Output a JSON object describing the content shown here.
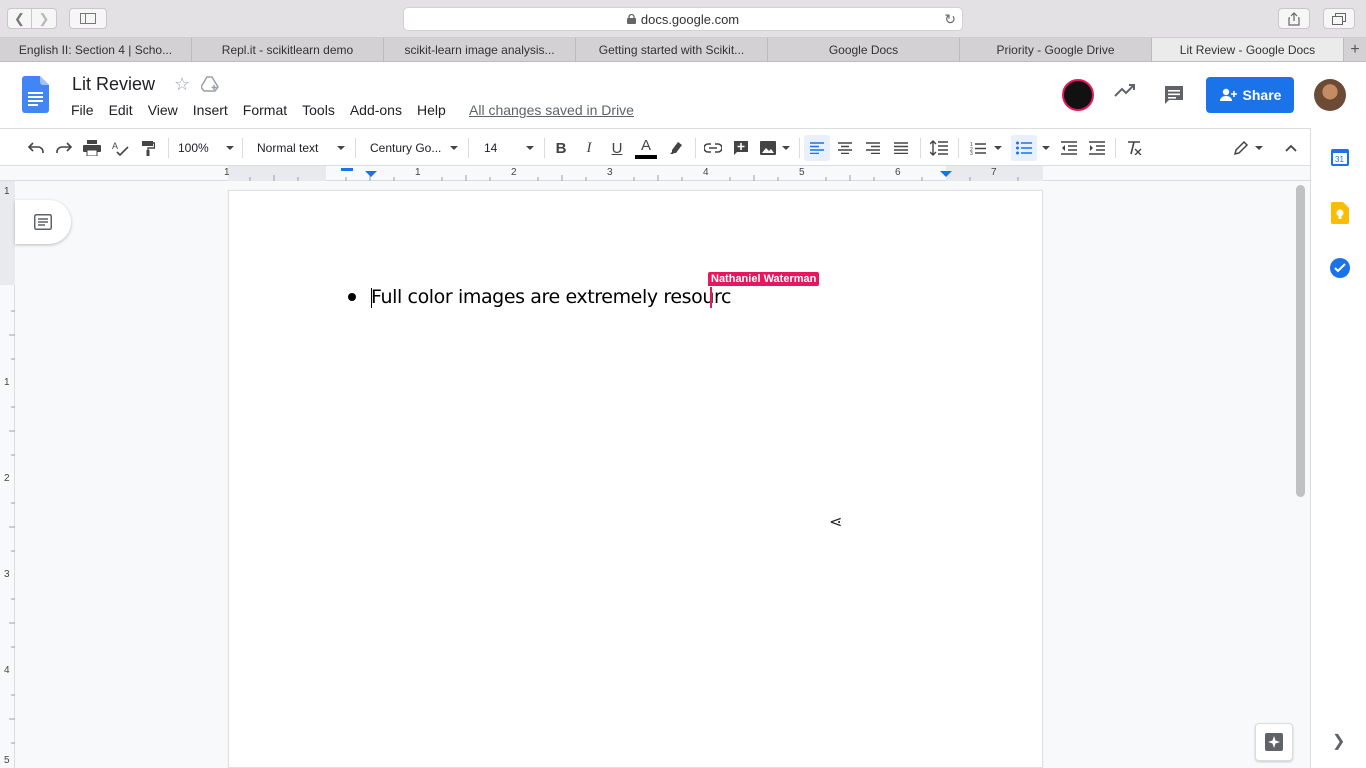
{
  "browser": {
    "url": "docs.google.com",
    "tabs": [
      {
        "label": "English II: Section 4 | Scho..."
      },
      {
        "label": "Repl.it - scikitlearn demo"
      },
      {
        "label": "scikit-learn image analysis..."
      },
      {
        "label": "Getting started with Scikit..."
      },
      {
        "label": "Google Docs"
      },
      {
        "label": "Priority - Google Drive"
      },
      {
        "label": "Lit Review - Google Docs"
      }
    ],
    "new_tab_label": "+"
  },
  "docs": {
    "title": "Lit Review",
    "menu": [
      "File",
      "Edit",
      "View",
      "Insert",
      "Format",
      "Tools",
      "Add-ons",
      "Help"
    ],
    "save_status": "All changes saved in Drive",
    "share_label": "Share"
  },
  "toolbar": {
    "zoom": "100%",
    "style": "Normal text",
    "font": "Century Go...",
    "font_size": "14",
    "bold": "B",
    "italic": "I",
    "underline": "U",
    "text_color_letter": "A"
  },
  "ruler": {
    "h_numbers": [
      "1",
      "1",
      "2",
      "3",
      "4",
      "5",
      "6",
      "7"
    ],
    "v_numbers": [
      "1",
      "1",
      "2",
      "3",
      "4",
      "5"
    ]
  },
  "document": {
    "bullet_text": "Full color images are extremely resourc",
    "collaborator_name": "Nathaniel Waterman"
  },
  "colors": {
    "accent": "#1a73e8",
    "collaborator": "#e8175d"
  }
}
